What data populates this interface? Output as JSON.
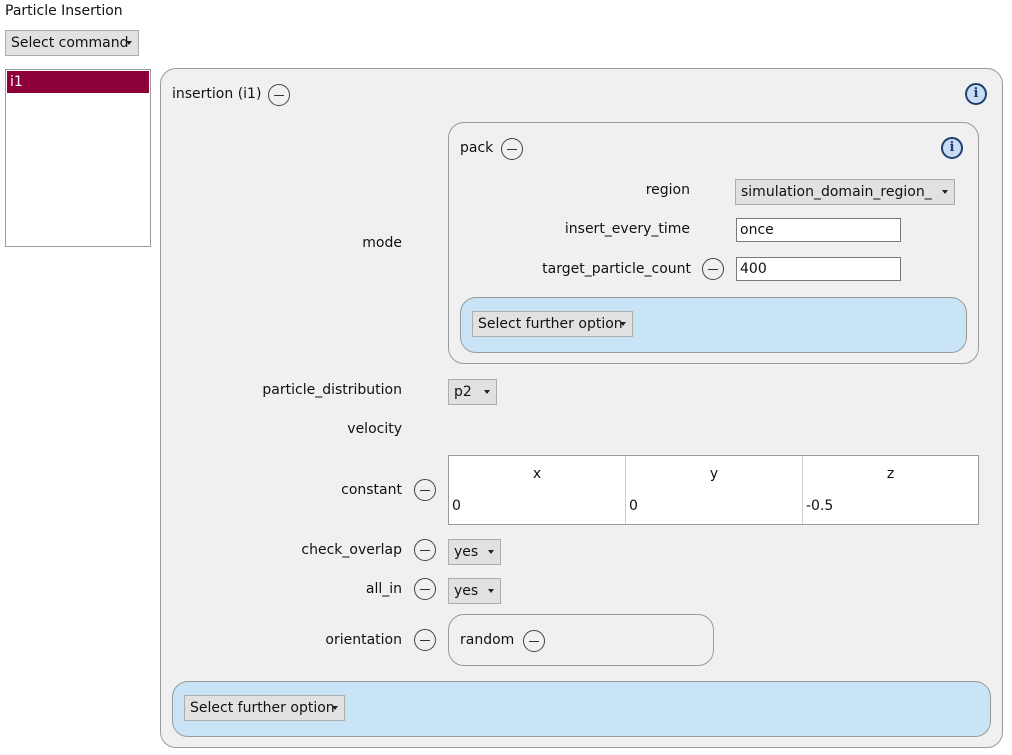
{
  "window": {
    "title": "Particle Insertion"
  },
  "toolbar": {
    "command_combo": "Select command"
  },
  "list": {
    "items": [
      "i1"
    ]
  },
  "insertion": {
    "title": "insertion (i1)",
    "mode_label": "mode",
    "pack": {
      "title": "pack",
      "region_label": "region",
      "region_value": "simulation_domain_region_",
      "insert_every_time_label": "insert_every_time",
      "insert_every_time_value": "once",
      "target_particle_count_label": "target_particle_count",
      "target_particle_count_value": "400",
      "further_option": "Select further option"
    },
    "particle_distribution_label": "particle_distribution",
    "particle_distribution_value": "p2",
    "velocity_label": "velocity",
    "constant_label": "constant",
    "constant": {
      "columns": [
        "x",
        "y",
        "z"
      ],
      "values": [
        "0",
        "0",
        "-0.5"
      ]
    },
    "check_overlap_label": "check_overlap",
    "check_overlap_value": "yes",
    "all_in_label": "all_in",
    "all_in_value": "yes",
    "orientation_label": "orientation",
    "orientation_value": "random",
    "further_option": "Select further option"
  },
  "colors": {
    "selection": "#8e0038",
    "panel_bg": "#f0f0f0",
    "option_bg": "#c9e3f7"
  }
}
